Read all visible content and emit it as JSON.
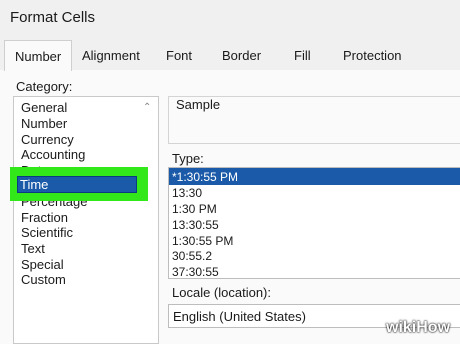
{
  "window": {
    "title": "Format Cells"
  },
  "tabs": [
    {
      "label": "Number",
      "active": true
    },
    {
      "label": "Alignment"
    },
    {
      "label": "Font"
    },
    {
      "label": "Border"
    },
    {
      "label": "Fill"
    },
    {
      "label": "Protection"
    }
  ],
  "category": {
    "label": "Category:",
    "items": [
      "General",
      "Number",
      "Currency",
      "Accounting",
      "Date",
      "Time",
      "Percentage",
      "Fraction",
      "Scientific",
      "Text",
      "Special",
      "Custom"
    ],
    "selected": "Time"
  },
  "sample": {
    "label": "Sample"
  },
  "type": {
    "label": "Type:",
    "items": [
      "*1:30:55 PM",
      "13:30",
      "1:30 PM",
      "13:30:55",
      "1:30:55 PM",
      "30:55.2",
      "37:30:55"
    ],
    "selected": "*1:30:55 PM"
  },
  "locale": {
    "label": "Locale (location):",
    "value": "English (United States)"
  },
  "watermark": {
    "text": "wikiHow"
  },
  "colors": {
    "selection": "#1a5aa8",
    "highlight": "#33e81a"
  }
}
